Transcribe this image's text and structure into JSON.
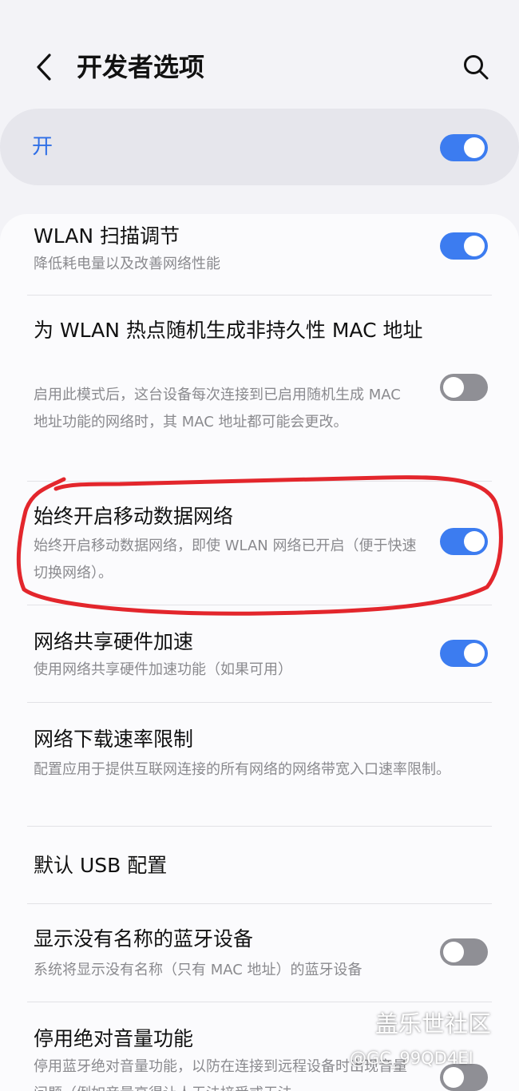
{
  "header": {
    "title": "开发者选项",
    "back_icon": "chevron-left-icon",
    "search_icon": "search-icon"
  },
  "master": {
    "label": "开",
    "toggle_on": true
  },
  "settings": [
    {
      "title": "WLAN 扫描调节",
      "subtitle": "降低耗电量以及改善网络性能",
      "toggle_on": true
    },
    {
      "title": "为 WLAN 热点随机生成非持久性 MAC 地址",
      "subtitle": "启用此模式后，这台设备每次连接到已启用随机生成 MAC 地址功能的网络时，其 MAC 地址都可能会更改。",
      "toggle_on": false
    },
    {
      "title": "始终开启移动数据网络",
      "subtitle": "始终开启移动数据网络，即使 WLAN 网络已开启（便于快速切换网络）。",
      "toggle_on": true
    },
    {
      "title": "网络共享硬件加速",
      "subtitle": "使用网络共享硬件加速功能（如果可用）",
      "toggle_on": true
    },
    {
      "title": "网络下载速率限制",
      "subtitle": "配置应用于提供互联网连接的所有网络的网络带宽入口速率限制。"
    },
    {
      "title": "默认 USB 配置"
    },
    {
      "title": "显示没有名称的蓝牙设备",
      "subtitle": "系统将显示没有名称（只有 MAC 地址）的蓝牙设备",
      "toggle_on": false
    },
    {
      "title": "停用绝对音量功能",
      "subtitle": "停用蓝牙绝对音量功能，以防在连接到远程设备时出现音量问题（例如音量高得让人无法接受或无法",
      "toggle_on": false
    }
  ],
  "colors": {
    "accent": "#3c7cf0",
    "toggle_off": "#8f8f95",
    "annotation": "#e3262c"
  },
  "watermark": {
    "brand": "盖乐世社区",
    "handle": "@GC_99QD4EI"
  }
}
